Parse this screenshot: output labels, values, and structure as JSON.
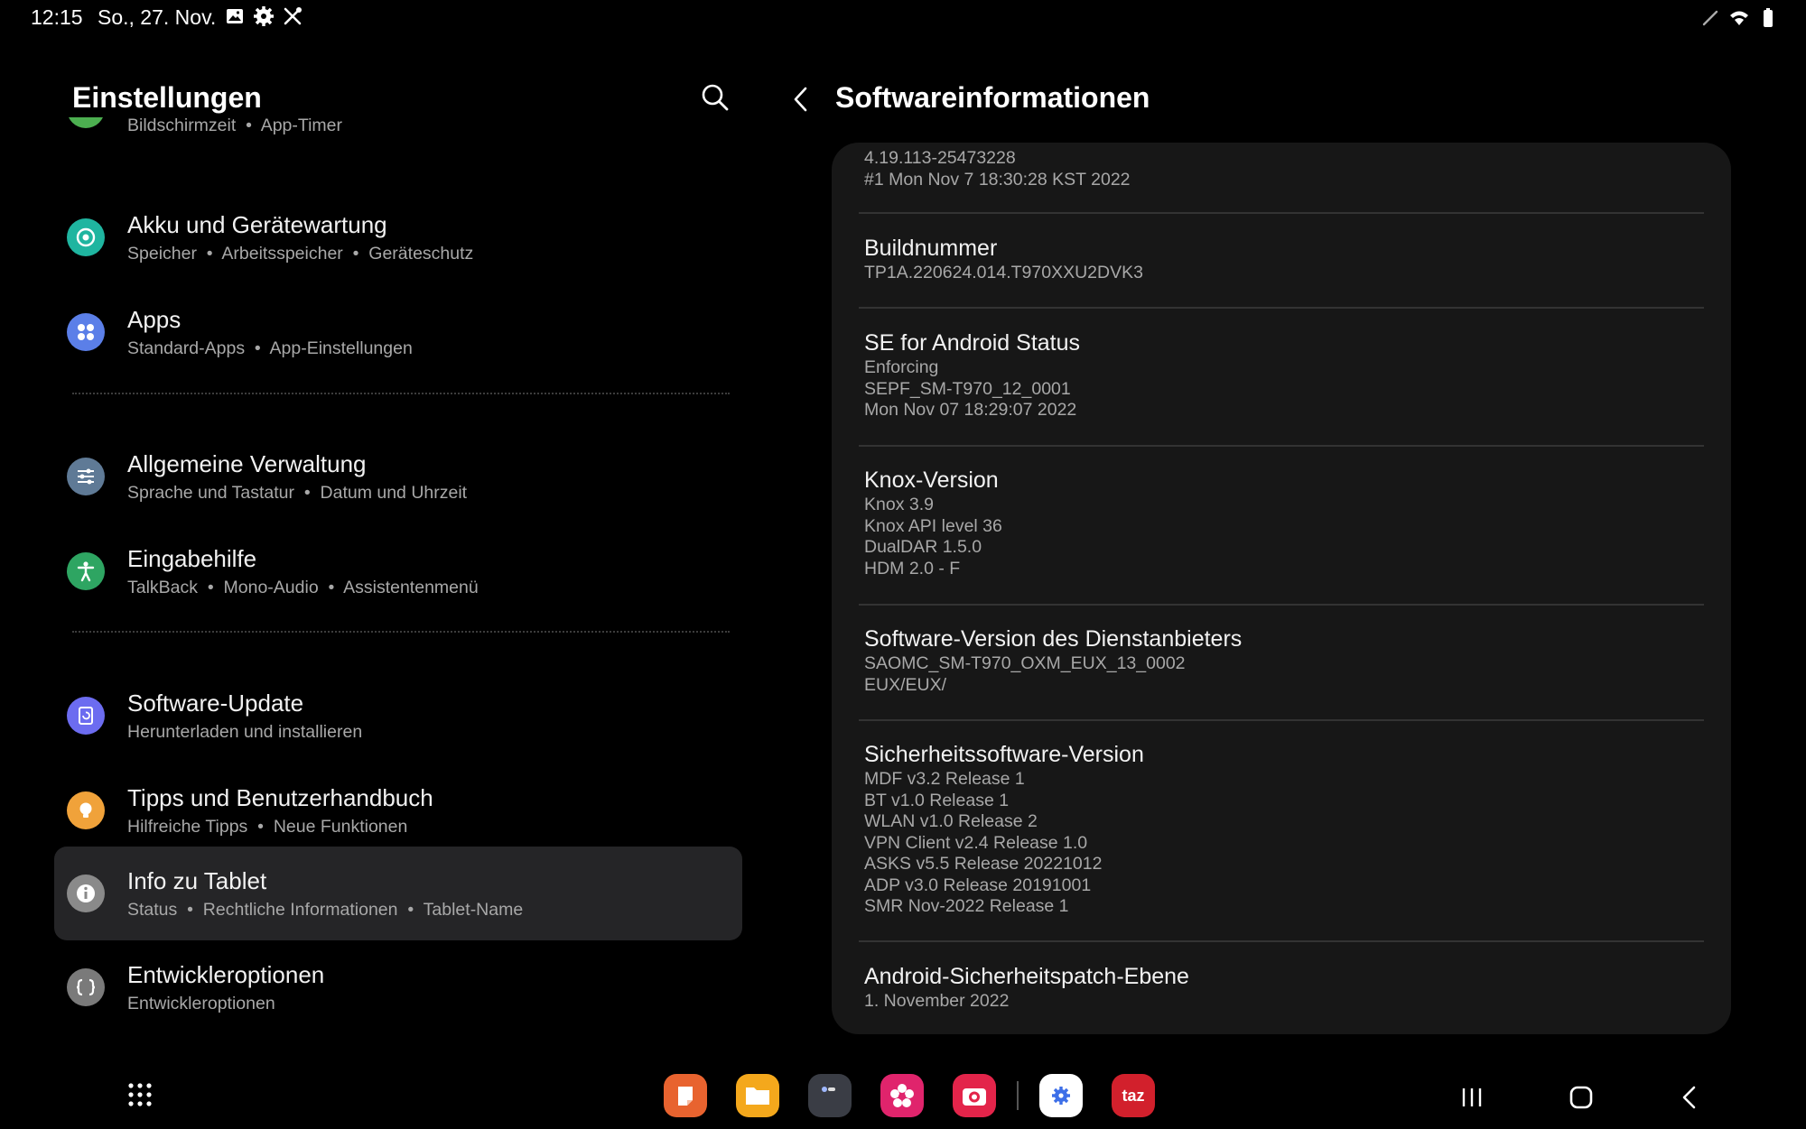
{
  "status_bar": {
    "time": "12:15",
    "date": "So., 27. Nov.",
    "left_icons": [
      "gallery-icon",
      "settings-gear-icon",
      "tools-icon"
    ],
    "right_icons": [
      "pen-icon",
      "wifi-icon",
      "battery-icon"
    ]
  },
  "left_pane": {
    "title": "Einstellungen",
    "items": [
      {
        "title": "",
        "sub_parts": [
          "Bildschirmzeit",
          "App-Timer"
        ],
        "icon": "wellbeing-icon",
        "color": "#4caf50"
      },
      {
        "title": "Akku und Gerätewartung",
        "sub_parts": [
          "Speicher",
          "Arbeitsspeicher",
          "Geräteschutz"
        ],
        "icon": "device-care-icon",
        "color": "#1fb5a0"
      },
      {
        "title": "Apps",
        "sub_parts": [
          "Standard-Apps",
          "App-Einstellungen"
        ],
        "icon": "apps-icon",
        "color": "#5b7fe8"
      },
      {
        "title": "Allgemeine Verwaltung",
        "sub_parts": [
          "Sprache und Tastatur",
          "Datum und Uhrzeit"
        ],
        "icon": "general-management-icon",
        "color": "#5f7a96"
      },
      {
        "title": "Eingabehilfe",
        "sub_parts": [
          "TalkBack",
          "Mono-Audio",
          "Assistentenmenü"
        ],
        "icon": "accessibility-icon",
        "color": "#2ea562"
      },
      {
        "title": "Software-Update",
        "sub_parts": [
          "Herunterladen und installieren"
        ],
        "icon": "software-update-icon",
        "color": "#6c6cf0"
      },
      {
        "title": "Tipps und Benutzerhandbuch",
        "sub_parts": [
          "Hilfreiche Tipps",
          "Neue Funktionen"
        ],
        "icon": "tips-icon",
        "color": "#f0a23a"
      },
      {
        "title": "Info zu Tablet",
        "sub_parts": [
          "Status",
          "Rechtliche Informationen",
          "Tablet-Name"
        ],
        "icon": "info-icon",
        "color": "#8a8a8a"
      },
      {
        "title": "Entwickleroptionen",
        "sub_parts": [
          "Entwickleroptionen"
        ],
        "icon": "developer-options-icon",
        "color": "#7a7a7a"
      }
    ]
  },
  "right_pane": {
    "title": "Softwareinformationen",
    "blocks": [
      {
        "title": "",
        "lines": [
          "4.19.113-25473228",
          "#1 Mon Nov 7 18:30:28 KST 2022"
        ]
      },
      {
        "title": "Buildnummer",
        "lines": [
          "TP1A.220624.014.T970XXU2DVK3"
        ]
      },
      {
        "title": "SE for Android Status",
        "lines": [
          "Enforcing",
          "SEPF_SM-T970_12_0001",
          "Mon Nov 07 18:29:07 2022"
        ]
      },
      {
        "title": "Knox-Version",
        "lines": [
          "Knox 3.9",
          "Knox API level 36",
          "DualDAR 1.5.0",
          "HDM 2.0 - F"
        ]
      },
      {
        "title": "Software-Version des Dienstanbieters",
        "lines": [
          "SAOMC_SM-T970_OXM_EUX_13_0002",
          "EUX/EUX/"
        ]
      },
      {
        "title": "Sicherheitssoftware-Version",
        "lines": [
          "MDF v3.2 Release 1",
          "BT v1.0 Release 1",
          "WLAN v1.0 Release 2",
          "VPN Client v2.4 Release 1.0",
          "ASKS v5.5 Release 20221012",
          "ADP v3.0 Release 20191001",
          "SMR Nov-2022 Release 1"
        ]
      },
      {
        "title": "Android-Sicherheitspatch-Ebene",
        "lines": [
          "1. November 2022"
        ]
      }
    ]
  },
  "dock": {
    "apps": [
      {
        "name": "notes-app",
        "color": "#e8632f"
      },
      {
        "name": "files-app",
        "color": "#f4a81c"
      },
      {
        "name": "dark-app",
        "color": "#3a3d45"
      },
      {
        "name": "flower-app",
        "color": "#e0246c"
      },
      {
        "name": "camera-app",
        "color": "#e3244a"
      },
      {
        "name": "settings-app",
        "color": "#ffffff"
      },
      {
        "name": "taz-app",
        "color": "#d2202c",
        "label": "taz"
      }
    ]
  }
}
